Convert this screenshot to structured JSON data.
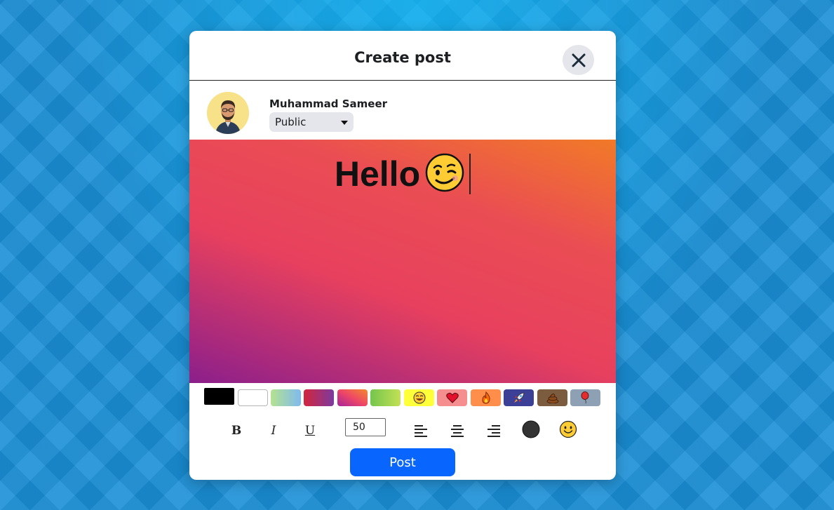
{
  "dialog": {
    "title": "Create post"
  },
  "user": {
    "name": "Muhammad Sameer",
    "privacy": "Public"
  },
  "post": {
    "text": "Hello",
    "emoji": "winking-face"
  },
  "backgrounds": [
    {
      "name": "black",
      "color": "#000000"
    },
    {
      "name": "white",
      "color": "#ffffff"
    },
    {
      "name": "green-blue-gradient",
      "color": "#8fd3b0"
    },
    {
      "name": "red-purple-gradient",
      "color": "#c8264d"
    },
    {
      "name": "orange-pink-purple-gradient",
      "color": "#e8435f"
    },
    {
      "name": "lime-green-gradient",
      "color": "#9bd94a"
    },
    {
      "name": "laughing-emoji-yellow",
      "color": "#ffff3a"
    },
    {
      "name": "heart-pink",
      "color": "#f58f8f"
    },
    {
      "name": "fire-orange",
      "color": "#ff8e4a"
    },
    {
      "name": "rocket-purple",
      "color": "#3b3f96"
    },
    {
      "name": "poop-brown",
      "color": "#7b5c3e"
    },
    {
      "name": "balloon-gray",
      "color": "#8ea1b4"
    }
  ],
  "formatting": {
    "bold": "B",
    "italic": "I",
    "underline": "U",
    "font_size": "50",
    "text_color": "#333333"
  },
  "actions": {
    "post_label": "Post"
  },
  "colors": {
    "accent": "#0866ff"
  }
}
